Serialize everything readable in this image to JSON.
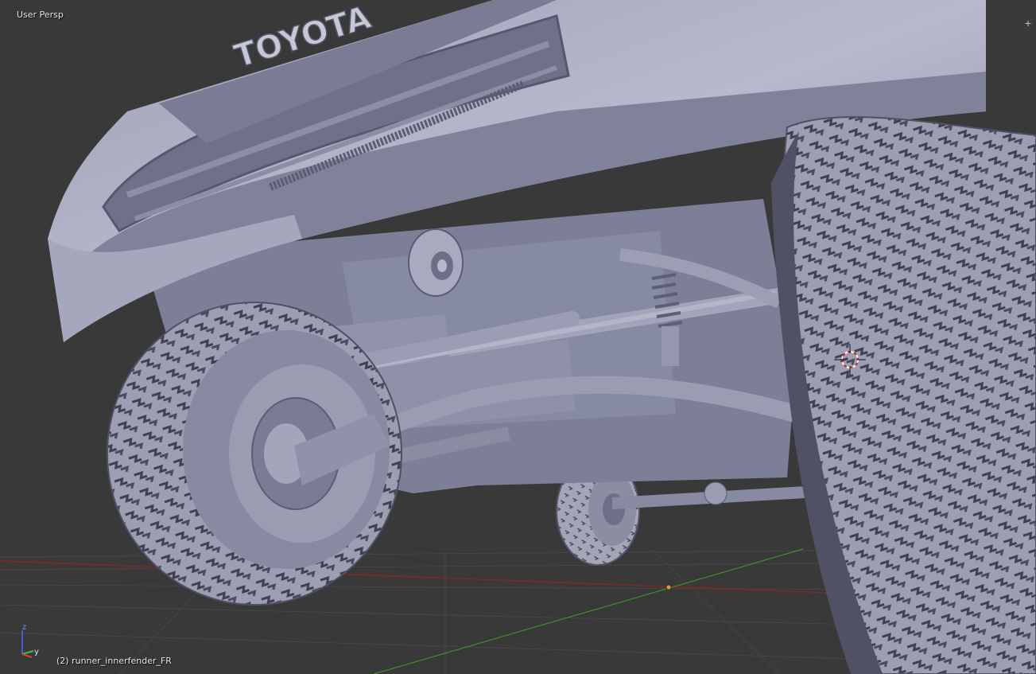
{
  "viewport": {
    "view_label": "User Persp",
    "object_label": "(2) runner_innerfender_FR",
    "corner_widget": "+",
    "scene_description_icons": [
      "toyota-4runner-model",
      "3d-cursor-icon",
      "origin-dot"
    ]
  },
  "grid": {
    "x_axis_color": "#8a2424",
    "y_axis_color": "#3d8f2a",
    "grid_color": "#454545"
  },
  "gizmo": {
    "z_label": "z",
    "y_label": "y",
    "z_color": "#3f5fd8",
    "y_color": "#3fbf3f",
    "x_color": "#d83f3f"
  },
  "model": {
    "grille_text": "TOYOTA"
  }
}
